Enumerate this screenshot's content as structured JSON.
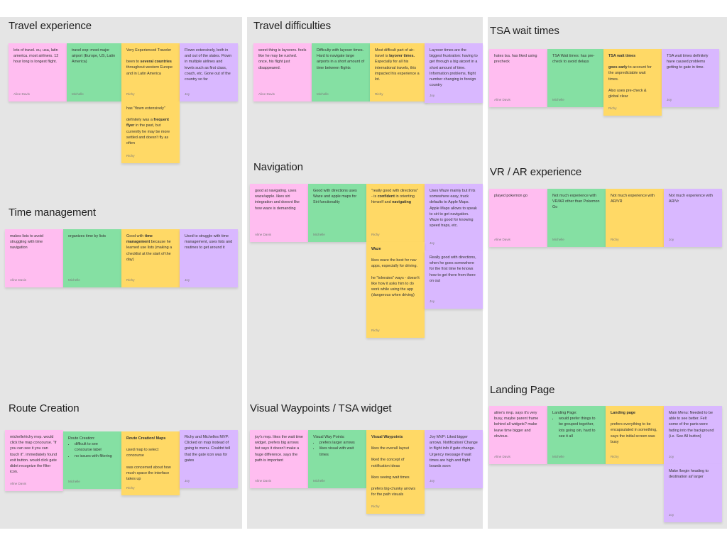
{
  "canvas": {
    "panels": [
      {
        "id": "left",
        "sections": [
          "Travel experience",
          "Time management",
          "Route Creation"
        ]
      },
      {
        "id": "middle",
        "sections": [
          "Travel difficulties",
          "Navigation",
          "Visual Waypoints / TSA widget"
        ]
      },
      {
        "id": "right",
        "sections": [
          "TSA wait times",
          "VR / AR experience",
          "Landing Page"
        ]
      }
    ]
  },
  "colors": {
    "pink": "#ffbdf0",
    "green": "#85e0a3",
    "yellow": "#ffd966",
    "purple": "#d9b8ff",
    "panel_bg": "#e5e5e5"
  },
  "authors": {
    "pink": "Aline Davis",
    "green": "Michelle",
    "yellow": "Richy",
    "purple": "Joy"
  },
  "sections": {
    "travel_experience": {
      "title": "Travel experience",
      "notes": [
        {
          "author": "Aline Davis",
          "text": "lots of travel. eu, usa, latin america. most airliners. 12 hour long is longest flight."
        },
        {
          "author": "Michelle",
          "text": "travel exp: most major airport (Europe, US, Latin America)"
        },
        {
          "author": "Richy",
          "lines": [
            "Very Experienced Traveler",
            "been to ",
            "several countries",
            " throughout western Europe and in Latin America"
          ]
        },
        {
          "author": "Joy",
          "text": "Flown extensively, both in and out of the states. Flown in multiple airlines and levels such as first class, coach, etc. Gone out of the country so far"
        },
        {
          "author": "Richy",
          "lines": [
            "has \"flown extensively\"",
            "definitely was a ",
            "frequent flyer",
            " in the past, but currently he may be more settled and doesn't fly as often"
          ]
        }
      ]
    },
    "time_management": {
      "title": "Time management",
      "notes": [
        {
          "author": "Aline Davis",
          "text": "makes lists to avoid struggling with time navigation"
        },
        {
          "author": "Michelle",
          "text": "organizes time by lists"
        },
        {
          "author": "Richy",
          "lines": [
            "Good with ",
            "time management",
            " because he learned use lists (making a checklist at the start of the day)"
          ]
        },
        {
          "author": "Joy",
          "text": "Used to struggle with time management, uses lists and routines to get around it"
        }
      ]
    },
    "route_creation": {
      "title": "Route Creation",
      "notes": [
        {
          "author": "Aline Davis",
          "text": "michelle/richy mvp. would click the map concourse. \"if you can see it you can touch it\". immediately found exit button. would click gate didnt recognize the filter icon."
        },
        {
          "author": "Michelle",
          "heading": "Route Creation:",
          "bullets": [
            "difficult to see concourse label",
            "no issues with filtering"
          ]
        },
        {
          "author": "Richy",
          "heading": "Route Creation/ Maps",
          "paras": [
            "used map to select concourse",
            "was concerned about how much space the interface takes up"
          ]
        },
        {
          "author": "Joy",
          "text": "Richy and Michelles MVP: Clicked on map instead of going to menu. Couldnt tell that the gate icon was for gates"
        }
      ]
    },
    "travel_difficulties": {
      "title": "Travel difficulties",
      "notes": [
        {
          "author": "Aline Davis",
          "text": "worst thing is layovers. feels like he may be rushed. once, his flight just disappeared."
        },
        {
          "author": "Michelle",
          "text": "Difficulty with layover times. Hard to navigate large airports in a short amount of time between flights"
        },
        {
          "author": "Richy",
          "lines": [
            "Most difficult part of air-travel is ",
            "layover times.",
            " Especially for all his international travels, this impacted his experience a lot."
          ]
        },
        {
          "author": "Joy",
          "text": "Layover times are the biggest frustration: having to get through a big airport in a short amount of time. Information problems, flight number changing in foreign country"
        }
      ]
    },
    "navigation": {
      "title": "Navigation",
      "notes": [
        {
          "author": "Aline Davis",
          "text": "good at navigating. uses waze/apple. likes siri integration and doesnt like how waze is demanding"
        },
        {
          "author": "Michelle",
          "text": "Good with directions uses Waze and apple maps for Siri functionality"
        },
        {
          "author": "Richy",
          "lines": [
            "\"really good with directions\" - is ",
            "confident",
            " in orienting himself and ",
            "navigating"
          ]
        },
        {
          "author": "Joy",
          "text": "Uses Waze mainly but if its somewhere easy, truck defaults to Apple Maps. Apple Maps allows to speak to siri to get navigation. Waze is good for knowing speed traps, etc."
        },
        {
          "author": "Richy",
          "heading": "Waze",
          "paras": [
            "likes waze the best for nav apps, especially for driving.",
            "he \"tolerates\" ways - doesn't like how it asks him to do work while using the app (dangerous when driving)"
          ]
        },
        {
          "author": "Joy",
          "text": "Really good with directions, when he goes somewhere for the first time he knows how to get there from there on out"
        }
      ]
    },
    "visual_waypoints": {
      "title": "Visual Waypoints / TSA widget",
      "notes": [
        {
          "author": "Aline Davis",
          "text": "joy's mvp. likes the wait time widget. prefers big arrows but says it doesn't make a huge difference. says the path is important"
        },
        {
          "author": "Michelle",
          "heading": "Visual Way Points:",
          "bullets": [
            "prefers larger arrows",
            "likes visual with wait times"
          ]
        },
        {
          "author": "Richy",
          "heading": "Visual Waypoints",
          "paras": [
            "likes the overall layout",
            "liked the concept of notification ideas",
            "likes seeing wait times",
            "prefers big-chunky arrows for the path visuals"
          ]
        },
        {
          "author": "Joy",
          "text": "Joy MVP: Liked bigger arrows. Notification/ Change in flight info if gate change. Urgency message if wait times are high and flight boards soon"
        }
      ]
    },
    "tsa_wait_times": {
      "title": "TSA wait times",
      "notes": [
        {
          "author": "Aline Davis",
          "text": "hates tsa. has liked using precheck"
        },
        {
          "author": "Michelle",
          "text": "TSA Wait times: has pre-check to avoid delays"
        },
        {
          "author": "Richy",
          "heading": "TSA wait times",
          "lead_bold": "goes early",
          "lead_rest": " to account for the unpredictable wait times.",
          "extra": "Also uses pre-check & global clear"
        },
        {
          "author": "Joy",
          "text": "TSA wait times definitely have caused problems getting to gate in time."
        }
      ]
    },
    "vr_ar": {
      "title": "VR / AR experience",
      "notes": [
        {
          "author": "Aline Davis",
          "text": "played pokemon go"
        },
        {
          "author": "Michelle",
          "text": "Not much experience with VR/AR other than Pokemon Go"
        },
        {
          "author": "Richy",
          "text": "Not much experience with AR/VR"
        },
        {
          "author": "Joy",
          "text": "Not much experience with AR/Vr"
        }
      ]
    },
    "landing_page": {
      "title": "Landing Page",
      "notes": [
        {
          "author": "Aline Davis",
          "text": "aline's mvp. says it's very busy, maybe parent frame behind all widgets? make leave time bigger and obvious."
        },
        {
          "author": "Michelle",
          "heading": "Landing Page:",
          "bullets": [
            "would prefer things to be grouped together, lots going oin, hard to see it all"
          ]
        },
        {
          "author": "Richy",
          "heading": "Landing page",
          "paras": [
            "prefers everything to be encapsulated in something, says the initial screen was busy"
          ]
        },
        {
          "author": "Joy",
          "text": "Main Menu: Needed to be able to see better. Felt some of the parts were fading into the background (i.e. See All button)"
        },
        {
          "author": "Joy",
          "text": "Make /begin heading to destination at/ larger"
        }
      ]
    }
  }
}
